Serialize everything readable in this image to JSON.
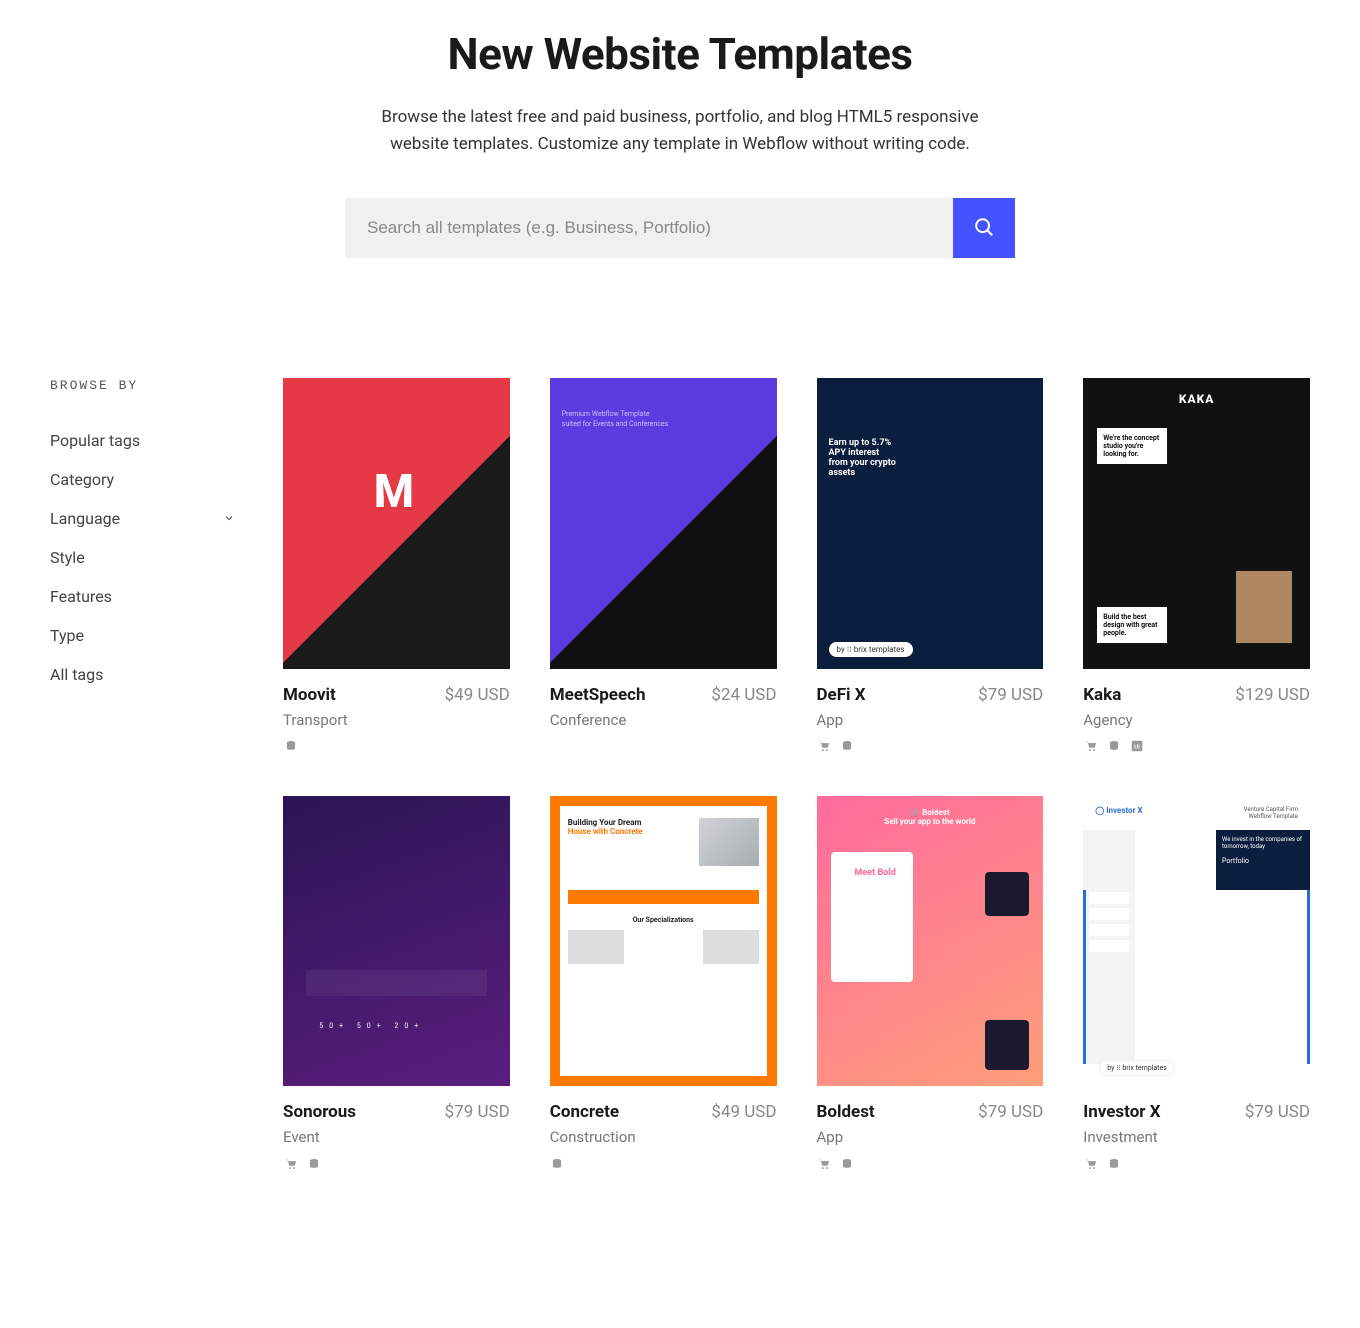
{
  "hero": {
    "title": "New Website Templates",
    "subtitle": "Browse the latest free and paid business, portfolio, and blog HTML5 responsive website templates. Customize any template in Webflow without writing code."
  },
  "search": {
    "placeholder": "Search all templates (e.g. Business, Portfolio)"
  },
  "sidebar": {
    "heading": "BROWSE BY",
    "items": [
      {
        "label": "Popular tags",
        "expandable": false
      },
      {
        "label": "Category",
        "expandable": false
      },
      {
        "label": "Language",
        "expandable": true
      },
      {
        "label": "Style",
        "expandable": false
      },
      {
        "label": "Features",
        "expandable": false
      },
      {
        "label": "Type",
        "expandable": false
      },
      {
        "label": "All tags",
        "expandable": false
      }
    ]
  },
  "templates": [
    {
      "name": "Moovit",
      "category": "Transport",
      "price": "$49 USD",
      "icons": [
        "stack"
      ],
      "thumbClass": "th-moovit"
    },
    {
      "name": "MeetSpeech",
      "category": "Conference",
      "price": "$24 USD",
      "icons": [],
      "thumbClass": "th-meetspeech"
    },
    {
      "name": "DeFi X",
      "category": "App",
      "price": "$79 USD",
      "icons": [
        "cart",
        "stack"
      ],
      "thumbClass": "th-defix"
    },
    {
      "name": "Kaka",
      "category": "Agency",
      "price": "$129 USD",
      "icons": [
        "cart",
        "stack",
        "ui"
      ],
      "thumbClass": "th-kaka"
    },
    {
      "name": "Sonorous",
      "category": "Event",
      "price": "$79 USD",
      "icons": [
        "cart",
        "stack"
      ],
      "thumbClass": "th-sonorous"
    },
    {
      "name": "Concrete",
      "category": "Construction",
      "price": "$49 USD",
      "icons": [
        "stack"
      ],
      "thumbClass": "th-concrete"
    },
    {
      "name": "Boldest",
      "category": "App",
      "price": "$79 USD",
      "icons": [
        "cart",
        "stack"
      ],
      "thumbClass": "th-boldest"
    },
    {
      "name": "Investor X",
      "category": "Investment",
      "price": "$79 USD",
      "icons": [
        "cart",
        "stack"
      ],
      "thumbClass": "th-investor"
    }
  ]
}
